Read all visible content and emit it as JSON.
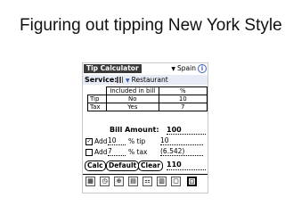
{
  "slide": {
    "title": "Figuring out tipping New York Style"
  },
  "app": {
    "title": "Tip Calculator",
    "country": "Spain",
    "info_icon": "i",
    "service_label": "Service:",
    "service_value": "Restaurant",
    "table": {
      "headers": [
        "Included in bill",
        "%"
      ],
      "rows": [
        {
          "label": "Tip",
          "included": "No",
          "pct": "10"
        },
        {
          "label": "Tax",
          "included": "Yes",
          "pct": "7"
        }
      ]
    },
    "bill_label": "Bill Amount:",
    "bill_value": "100",
    "add_rows": [
      {
        "checked": true,
        "label": "Add",
        "value": "10",
        "unit": "% tip",
        "result": "10"
      },
      {
        "checked": false,
        "label": "Add",
        "value": "7",
        "unit": "% tax",
        "result": "(6.542)"
      }
    ],
    "buttons": {
      "calc": "Calc",
      "default": "Default",
      "clear": "Clear"
    },
    "total": "110",
    "toolbar_icons": [
      "calculator-icon",
      "clock-icon",
      "globe-icon",
      "tax-icon",
      "split-icon",
      "bills-icon",
      "notes-icon",
      "tip-icon"
    ]
  }
}
